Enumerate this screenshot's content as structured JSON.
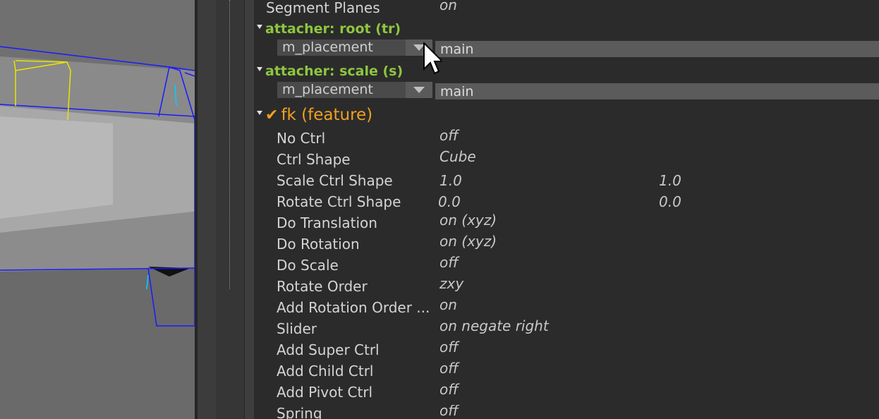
{
  "viewport": {
    "label": "3d-viewport"
  },
  "panel": {
    "segment_planes": {
      "label": "Segment Planes",
      "value": "on"
    },
    "attacher_root": {
      "header": "attacher: root (tr)",
      "select": "m_placement",
      "field": "main"
    },
    "attacher_scale": {
      "header": "attacher: scale (s)",
      "select": "m_placement",
      "field": "main"
    },
    "fk": {
      "header": "fk (feature)",
      "rows": [
        {
          "label": "No Ctrl",
          "value": "off"
        },
        {
          "label": "Ctrl Shape",
          "value": "Cube"
        },
        {
          "label": "Scale Ctrl Shape",
          "value": "1.0",
          "value2": "1.0"
        },
        {
          "label": "Rotate Ctrl Shape",
          "value": "0.0",
          "value2": "0.0"
        },
        {
          "label": "Do Translation",
          "value": "on (xyz)"
        },
        {
          "label": "Do Rotation",
          "value": "on (xyz)"
        },
        {
          "label": "Do Scale",
          "value": "off"
        },
        {
          "label": "Rotate Order",
          "value": "zxy"
        },
        {
          "label": "Add Rotation Order ...",
          "value": "on"
        },
        {
          "label": "Slider",
          "value": "on negate right"
        },
        {
          "label": "Add Super Ctrl",
          "value": "off"
        },
        {
          "label": "Add Child Ctrl",
          "value": "off"
        },
        {
          "label": "Add Pivot Ctrl",
          "value": "off"
        },
        {
          "label": "Spring",
          "value": "off"
        }
      ]
    }
  },
  "colors": {
    "attacher_header": "#8dc63f",
    "feature_header": "#f0a020",
    "panel_bg": "#2b2b2b"
  }
}
